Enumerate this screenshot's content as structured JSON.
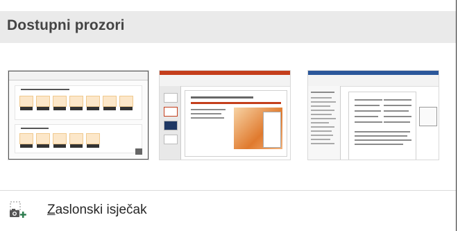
{
  "header": {
    "title": "Dostupni prozori"
  },
  "windows": [
    {
      "app": "browser",
      "selected": true
    },
    {
      "app": "powerpoint"
    },
    {
      "app": "word"
    }
  ],
  "screen_clipping": {
    "accesskey": "Z",
    "label_rest": "aslonski isječak"
  },
  "colors": {
    "header_bg": "#eaeaea",
    "accent_powerpoint": "#c43e1c",
    "accent_word": "#2b579a",
    "clip_icon": "#2e7d4f"
  }
}
